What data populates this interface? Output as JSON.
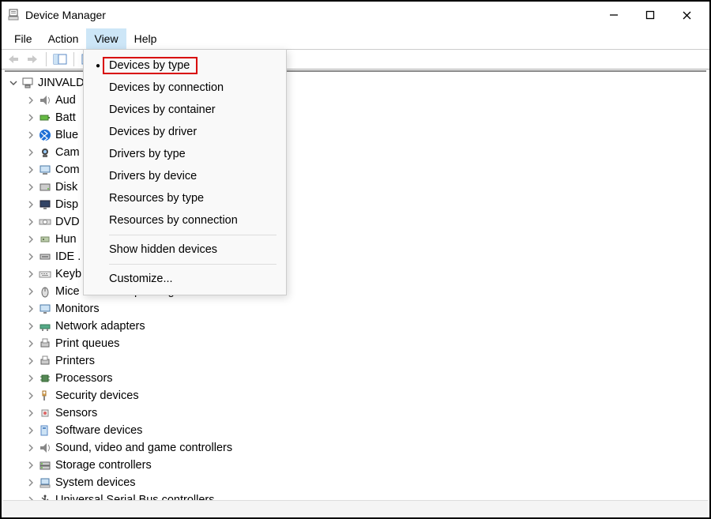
{
  "window": {
    "title": "Device Manager"
  },
  "menu": {
    "file": "File",
    "action": "Action",
    "view": "View",
    "help": "Help"
  },
  "view_menu": {
    "devices_by_type": "Devices by type",
    "devices_by_connection": "Devices by connection",
    "devices_by_container": "Devices by container",
    "devices_by_driver": "Devices by driver",
    "drivers_by_type": "Drivers by type",
    "drivers_by_device": "Drivers by device",
    "resources_by_type": "Resources by type",
    "resources_by_connection": "Resources by connection",
    "show_hidden": "Show hidden devices",
    "customize": "Customize..."
  },
  "tree": {
    "root": "JINVALD",
    "items": [
      {
        "icon": "audio-icon",
        "label": "Aud"
      },
      {
        "icon": "battery-icon",
        "label": "Batt"
      },
      {
        "icon": "bluetooth-icon",
        "label": "Blue"
      },
      {
        "icon": "camera-icon",
        "label": "Cam"
      },
      {
        "icon": "computer-icon",
        "label": "Com"
      },
      {
        "icon": "disk-icon",
        "label": "Disk"
      },
      {
        "icon": "display-icon",
        "label": "Disp"
      },
      {
        "icon": "dvd-icon",
        "label": "DVD"
      },
      {
        "icon": "hid-icon",
        "label": "Hun"
      },
      {
        "icon": "ide-icon",
        "label": "IDE ."
      },
      {
        "icon": "keyboard-icon",
        "label": "Keyb"
      },
      {
        "icon": "mouse-icon",
        "label": "Mice and other pointing devices"
      },
      {
        "icon": "monitor-icon",
        "label": "Monitors"
      },
      {
        "icon": "network-icon",
        "label": "Network adapters"
      },
      {
        "icon": "printqueue-icon",
        "label": "Print queues"
      },
      {
        "icon": "printer-icon",
        "label": "Printers"
      },
      {
        "icon": "processor-icon",
        "label": "Processors"
      },
      {
        "icon": "security-icon",
        "label": "Security devices"
      },
      {
        "icon": "sensor-icon",
        "label": "Sensors"
      },
      {
        "icon": "software-icon",
        "label": "Software devices"
      },
      {
        "icon": "sound-icon",
        "label": "Sound, video and game controllers"
      },
      {
        "icon": "storage-icon",
        "label": "Storage controllers"
      },
      {
        "icon": "system-icon",
        "label": "System devices"
      },
      {
        "icon": "usb-icon",
        "label": "Universal Serial Bus controllers"
      }
    ]
  }
}
